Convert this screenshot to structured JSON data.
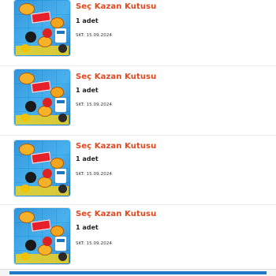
{
  "items": [
    {
      "title": "Seç Kazan Kutusu",
      "quantity": "1 adet",
      "skt": "SKT: 15.09.2024",
      "image_icon": "product-thumbnail-icon"
    },
    {
      "title": "Seç Kazan Kutusu",
      "quantity": "1 adet",
      "skt": "SKT: 15.09.2024",
      "image_icon": "product-thumbnail-icon"
    },
    {
      "title": "Seç Kazan Kutusu",
      "quantity": "1 adet",
      "skt": "SKT: 15.09.2024",
      "image_icon": "product-thumbnail-icon"
    },
    {
      "title": "Seç Kazan Kutusu",
      "quantity": "1 adet",
      "skt": "SKT: 15.09.2024",
      "image_icon": "product-thumbnail-icon"
    }
  ],
  "colors": {
    "title": "#e3461b",
    "accent": "#1f78c8"
  }
}
